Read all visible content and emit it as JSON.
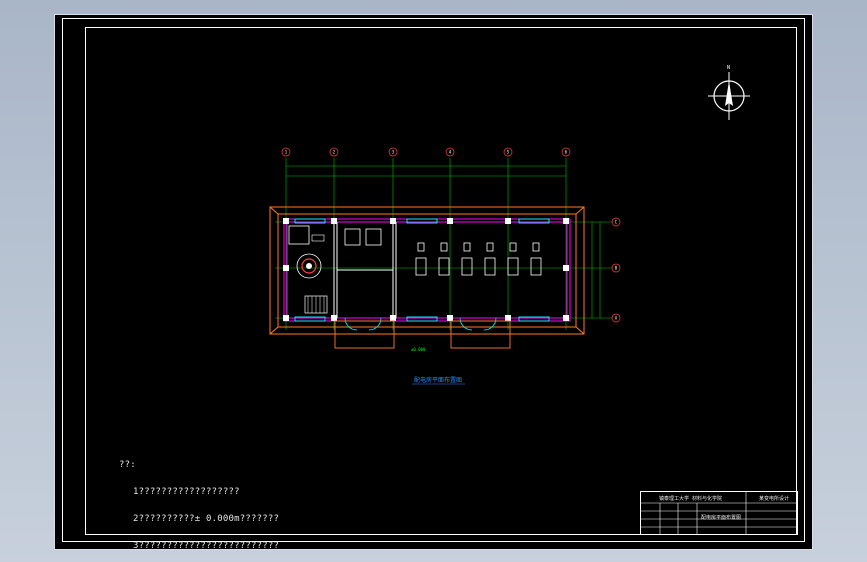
{
  "drawing": {
    "axis_labels_top": [
      "1",
      "2",
      "3",
      "4",
      "5",
      "6"
    ],
    "axis_labels_right": [
      "C",
      "B",
      "A"
    ],
    "caption": "配电房平面布置图",
    "elevation_mark": "±0.000",
    "north_arrow_label": "N"
  },
  "notes": {
    "heading": "??:",
    "lines": [
      "1??????????????????",
      "2??????????± 0.000m???????",
      "3?????????????????????????"
    ]
  },
  "title_block": {
    "school": "镇泰理工大学  材料与化学院",
    "drawing_title": "配电房平面布置图",
    "project": "某变电所设计"
  },
  "colors": {
    "background": "#000000",
    "frame": "#ffffff",
    "axis": "#00ff00",
    "wall": "#ff7a2a",
    "partition": "#ff00ff",
    "window": "#00ffff",
    "label": "#1e90ff"
  }
}
